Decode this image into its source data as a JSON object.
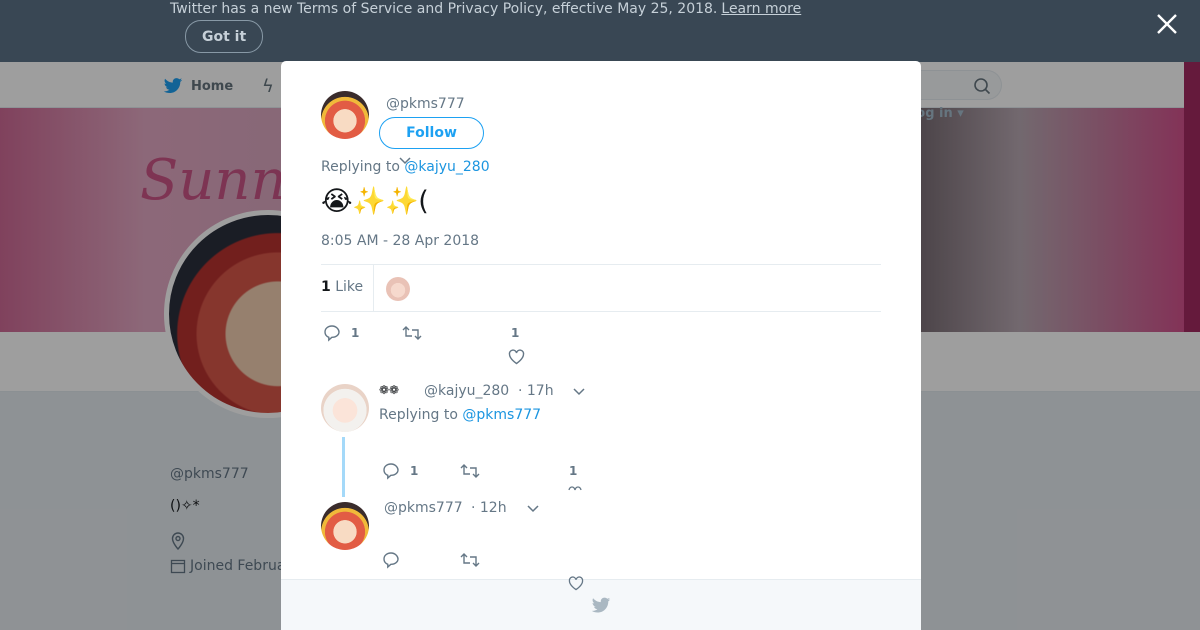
{
  "notice": {
    "text": "Twitter has a new Terms of Service and Privacy Policy, effective May 25, 2018.",
    "link": "Learn more",
    "button": "Got it"
  },
  "nav": {
    "home": "Home",
    "login": "Log in"
  },
  "profile": {
    "name": "",
    "handle": "@pkms777",
    "bio": "()✧*",
    "joined": "Joined Februa"
  },
  "tweet": {
    "author_handle": "@pkms777",
    "follow_label": "Follow",
    "replying_prefix": "Replying to ",
    "replying_to": "@kajyu_280",
    "text": "😭✨✨(",
    "timestamp": "8:05 AM - 28 Apr 2018",
    "likes_count": "1",
    "likes_label": "Like",
    "reply_count": "1",
    "like_count": "1"
  },
  "replies": [
    {
      "name": "❁❁",
      "handle": "@kajyu_280",
      "time": "· 17h",
      "replying_prefix": "Replying to ",
      "replying_to": "@pkms777",
      "reply_count": "1",
      "like_count": "1"
    },
    {
      "handle": "@pkms777",
      "time": "· 12h"
    }
  ],
  "colors": {
    "accent": "#1da1f2",
    "link": "#1b95e0",
    "notice_bg": "#394754",
    "muted": "#657786"
  }
}
